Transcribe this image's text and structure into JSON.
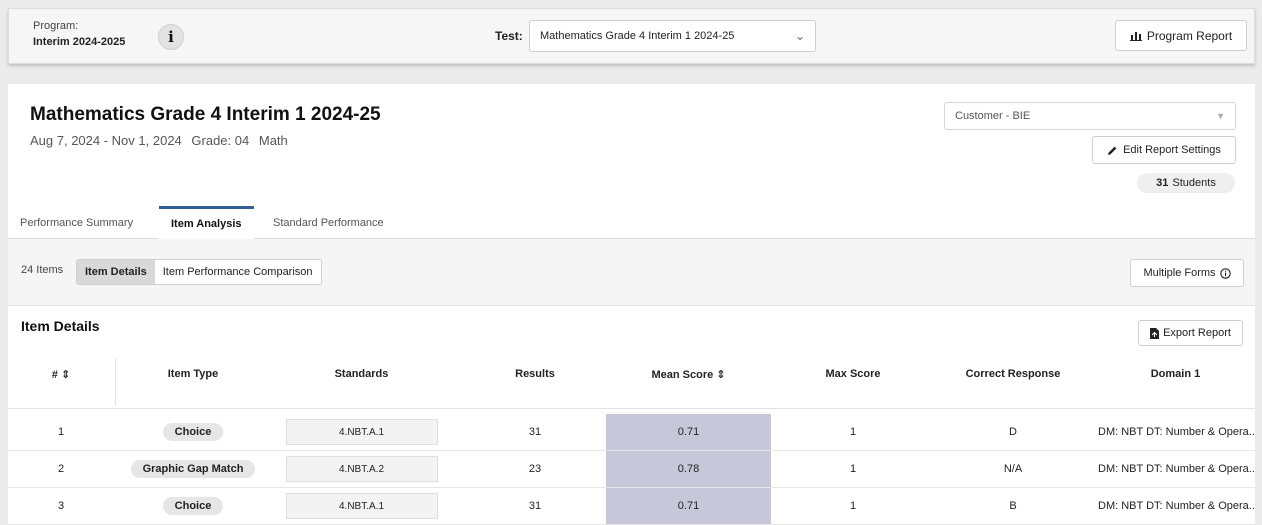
{
  "header": {
    "program_label": "Program:",
    "program_value": "Interim 2024-2025",
    "test_label": "Test:",
    "test_value": "Mathematics Grade 4 Interim 1 2024-25",
    "program_report_label": "Program Report"
  },
  "report": {
    "title": "Mathematics Grade 4 Interim 1 2024-25",
    "date_range": "Aug 7, 2024 - Nov 1, 2024",
    "grade": "Grade: 04",
    "subject": "Math",
    "customer": "Customer - BIE",
    "edit_label": "Edit Report Settings",
    "students_count": "31",
    "students_label": "Students"
  },
  "tabs": [
    "Performance Summary",
    "Item Analysis",
    "Standard Performance"
  ],
  "subbar": {
    "items_count": "24 Items",
    "view_item_details": "Item Details",
    "view_comparison": "Item Performance Comparison",
    "multiple_forms_label": "Multiple Forms"
  },
  "section": {
    "title": "Item Details",
    "export_label": "Export Report"
  },
  "table": {
    "columns": [
      "#",
      "Item Type",
      "Standards",
      "Results",
      "Mean Score",
      "Max Score",
      "Correct Response",
      "Domain 1"
    ],
    "rows": [
      {
        "num": "1",
        "type": "Choice",
        "standard": "4.NBT.A.1",
        "results": "31",
        "mean": "0.71",
        "max": "1",
        "correct": "D",
        "domain": "DM: NBT DT: Number & Opera..."
      },
      {
        "num": "2",
        "type": "Graphic Gap Match",
        "standard": "4.NBT.A.2",
        "results": "23",
        "mean": "0.78",
        "max": "1",
        "correct": "N/A",
        "domain": "DM: NBT DT: Number & Opera..."
      },
      {
        "num": "3",
        "type": "Choice",
        "standard": "4.NBT.A.1",
        "results": "31",
        "mean": "0.71",
        "max": "1",
        "correct": "B",
        "domain": "DM: NBT DT: Number & Opera..."
      }
    ]
  },
  "colors": {
    "accent_tab": "#2f5f93",
    "mean_highlight": "#c8c7d9"
  }
}
